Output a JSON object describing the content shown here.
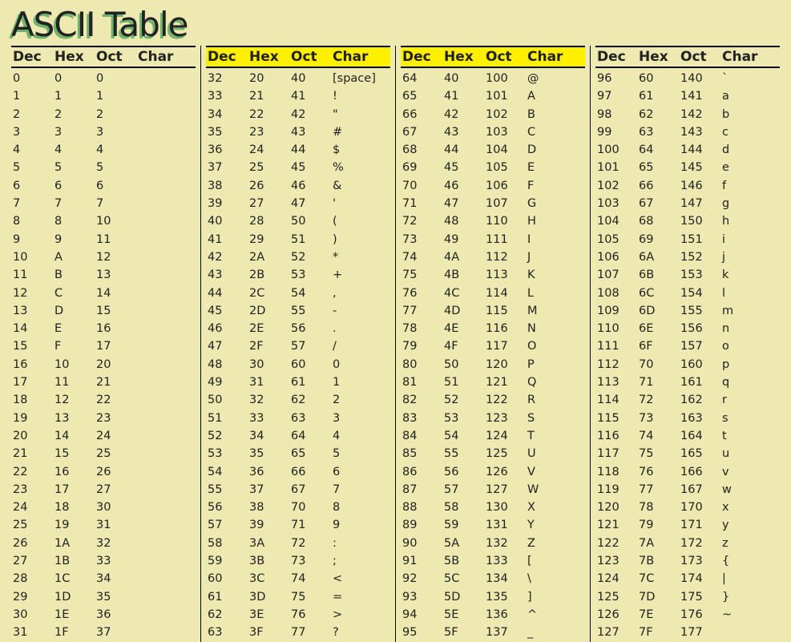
{
  "title": "ASCII Table",
  "headers": {
    "dec": "Dec",
    "hex": "Hex",
    "oct": "Oct",
    "char": "Char"
  },
  "highlight_blocks": [
    1,
    2
  ],
  "blocks": [
    [
      {
        "dec": "0",
        "hex": "0",
        "oct": "0",
        "char": ""
      },
      {
        "dec": "1",
        "hex": "1",
        "oct": "1",
        "char": ""
      },
      {
        "dec": "2",
        "hex": "2",
        "oct": "2",
        "char": ""
      },
      {
        "dec": "3",
        "hex": "3",
        "oct": "3",
        "char": ""
      },
      {
        "dec": "4",
        "hex": "4",
        "oct": "4",
        "char": ""
      },
      {
        "dec": "5",
        "hex": "5",
        "oct": "5",
        "char": ""
      },
      {
        "dec": "6",
        "hex": "6",
        "oct": "6",
        "char": ""
      },
      {
        "dec": "7",
        "hex": "7",
        "oct": "7",
        "char": ""
      },
      {
        "dec": "8",
        "hex": "8",
        "oct": "10",
        "char": ""
      },
      {
        "dec": "9",
        "hex": "9",
        "oct": "11",
        "char": ""
      },
      {
        "dec": "10",
        "hex": "A",
        "oct": "12",
        "char": ""
      },
      {
        "dec": "11",
        "hex": "B",
        "oct": "13",
        "char": ""
      },
      {
        "dec": "12",
        "hex": "C",
        "oct": "14",
        "char": ""
      },
      {
        "dec": "13",
        "hex": "D",
        "oct": "15",
        "char": ""
      },
      {
        "dec": "14",
        "hex": "E",
        "oct": "16",
        "char": ""
      },
      {
        "dec": "15",
        "hex": "F",
        "oct": "17",
        "char": ""
      },
      {
        "dec": "16",
        "hex": "10",
        "oct": "20",
        "char": ""
      },
      {
        "dec": "17",
        "hex": "11",
        "oct": "21",
        "char": ""
      },
      {
        "dec": "18",
        "hex": "12",
        "oct": "22",
        "char": ""
      },
      {
        "dec": "19",
        "hex": "13",
        "oct": "23",
        "char": ""
      },
      {
        "dec": "20",
        "hex": "14",
        "oct": "24",
        "char": ""
      },
      {
        "dec": "21",
        "hex": "15",
        "oct": "25",
        "char": ""
      },
      {
        "dec": "22",
        "hex": "16",
        "oct": "26",
        "char": ""
      },
      {
        "dec": "23",
        "hex": "17",
        "oct": "27",
        "char": ""
      },
      {
        "dec": "24",
        "hex": "18",
        "oct": "30",
        "char": ""
      },
      {
        "dec": "25",
        "hex": "19",
        "oct": "31",
        "char": ""
      },
      {
        "dec": "26",
        "hex": "1A",
        "oct": "32",
        "char": ""
      },
      {
        "dec": "27",
        "hex": "1B",
        "oct": "33",
        "char": ""
      },
      {
        "dec": "28",
        "hex": "1C",
        "oct": "34",
        "char": ""
      },
      {
        "dec": "29",
        "hex": "1D",
        "oct": "35",
        "char": ""
      },
      {
        "dec": "30",
        "hex": "1E",
        "oct": "36",
        "char": ""
      },
      {
        "dec": "31",
        "hex": "1F",
        "oct": "37",
        "char": ""
      }
    ],
    [
      {
        "dec": "32",
        "hex": "20",
        "oct": "40",
        "char": "[space]"
      },
      {
        "dec": "33",
        "hex": "21",
        "oct": "41",
        "char": "!"
      },
      {
        "dec": "34",
        "hex": "22",
        "oct": "42",
        "char": "\""
      },
      {
        "dec": "35",
        "hex": "23",
        "oct": "43",
        "char": "#"
      },
      {
        "dec": "36",
        "hex": "24",
        "oct": "44",
        "char": "$"
      },
      {
        "dec": "37",
        "hex": "25",
        "oct": "45",
        "char": "%"
      },
      {
        "dec": "38",
        "hex": "26",
        "oct": "46",
        "char": "&"
      },
      {
        "dec": "39",
        "hex": "27",
        "oct": "47",
        "char": "'"
      },
      {
        "dec": "40",
        "hex": "28",
        "oct": "50",
        "char": "("
      },
      {
        "dec": "41",
        "hex": "29",
        "oct": "51",
        "char": ")"
      },
      {
        "dec": "42",
        "hex": "2A",
        "oct": "52",
        "char": "*"
      },
      {
        "dec": "43",
        "hex": "2B",
        "oct": "53",
        "char": "+"
      },
      {
        "dec": "44",
        "hex": "2C",
        "oct": "54",
        "char": ","
      },
      {
        "dec": "45",
        "hex": "2D",
        "oct": "55",
        "char": "-"
      },
      {
        "dec": "46",
        "hex": "2E",
        "oct": "56",
        "char": "."
      },
      {
        "dec": "47",
        "hex": "2F",
        "oct": "57",
        "char": "/"
      },
      {
        "dec": "48",
        "hex": "30",
        "oct": "60",
        "char": "0"
      },
      {
        "dec": "49",
        "hex": "31",
        "oct": "61",
        "char": "1"
      },
      {
        "dec": "50",
        "hex": "32",
        "oct": "62",
        "char": "2"
      },
      {
        "dec": "51",
        "hex": "33",
        "oct": "63",
        "char": "3"
      },
      {
        "dec": "52",
        "hex": "34",
        "oct": "64",
        "char": "4"
      },
      {
        "dec": "53",
        "hex": "35",
        "oct": "65",
        "char": "5"
      },
      {
        "dec": "54",
        "hex": "36",
        "oct": "66",
        "char": "6"
      },
      {
        "dec": "55",
        "hex": "37",
        "oct": "67",
        "char": "7"
      },
      {
        "dec": "56",
        "hex": "38",
        "oct": "70",
        "char": "8"
      },
      {
        "dec": "57",
        "hex": "39",
        "oct": "71",
        "char": "9"
      },
      {
        "dec": "58",
        "hex": "3A",
        "oct": "72",
        "char": ":"
      },
      {
        "dec": "59",
        "hex": "3B",
        "oct": "73",
        "char": ";"
      },
      {
        "dec": "60",
        "hex": "3C",
        "oct": "74",
        "char": "<"
      },
      {
        "dec": "61",
        "hex": "3D",
        "oct": "75",
        "char": "="
      },
      {
        "dec": "62",
        "hex": "3E",
        "oct": "76",
        "char": ">"
      },
      {
        "dec": "63",
        "hex": "3F",
        "oct": "77",
        "char": "?"
      }
    ],
    [
      {
        "dec": "64",
        "hex": "40",
        "oct": "100",
        "char": "@"
      },
      {
        "dec": "65",
        "hex": "41",
        "oct": "101",
        "char": "A"
      },
      {
        "dec": "66",
        "hex": "42",
        "oct": "102",
        "char": "B"
      },
      {
        "dec": "67",
        "hex": "43",
        "oct": "103",
        "char": "C"
      },
      {
        "dec": "68",
        "hex": "44",
        "oct": "104",
        "char": "D"
      },
      {
        "dec": "69",
        "hex": "45",
        "oct": "105",
        "char": "E"
      },
      {
        "dec": "70",
        "hex": "46",
        "oct": "106",
        "char": "F"
      },
      {
        "dec": "71",
        "hex": "47",
        "oct": "107",
        "char": "G"
      },
      {
        "dec": "72",
        "hex": "48",
        "oct": "110",
        "char": "H"
      },
      {
        "dec": "73",
        "hex": "49",
        "oct": "111",
        "char": "I"
      },
      {
        "dec": "74",
        "hex": "4A",
        "oct": "112",
        "char": "J"
      },
      {
        "dec": "75",
        "hex": "4B",
        "oct": "113",
        "char": "K"
      },
      {
        "dec": "76",
        "hex": "4C",
        "oct": "114",
        "char": "L"
      },
      {
        "dec": "77",
        "hex": "4D",
        "oct": "115",
        "char": "M"
      },
      {
        "dec": "78",
        "hex": "4E",
        "oct": "116",
        "char": "N"
      },
      {
        "dec": "79",
        "hex": "4F",
        "oct": "117",
        "char": "O"
      },
      {
        "dec": "80",
        "hex": "50",
        "oct": "120",
        "char": "P"
      },
      {
        "dec": "81",
        "hex": "51",
        "oct": "121",
        "char": "Q"
      },
      {
        "dec": "82",
        "hex": "52",
        "oct": "122",
        "char": "R"
      },
      {
        "dec": "83",
        "hex": "53",
        "oct": "123",
        "char": "S"
      },
      {
        "dec": "84",
        "hex": "54",
        "oct": "124",
        "char": "T"
      },
      {
        "dec": "85",
        "hex": "55",
        "oct": "125",
        "char": "U"
      },
      {
        "dec": "86",
        "hex": "56",
        "oct": "126",
        "char": "V"
      },
      {
        "dec": "87",
        "hex": "57",
        "oct": "127",
        "char": "W"
      },
      {
        "dec": "88",
        "hex": "58",
        "oct": "130",
        "char": "X"
      },
      {
        "dec": "89",
        "hex": "59",
        "oct": "131",
        "char": "Y"
      },
      {
        "dec": "90",
        "hex": "5A",
        "oct": "132",
        "char": "Z"
      },
      {
        "dec": "91",
        "hex": "5B",
        "oct": "133",
        "char": "["
      },
      {
        "dec": "92",
        "hex": "5C",
        "oct": "134",
        "char": "\\"
      },
      {
        "dec": "93",
        "hex": "5D",
        "oct": "135",
        "char": "]"
      },
      {
        "dec": "94",
        "hex": "5E",
        "oct": "136",
        "char": "^"
      },
      {
        "dec": "95",
        "hex": "5F",
        "oct": "137",
        "char": "_"
      }
    ],
    [
      {
        "dec": "96",
        "hex": "60",
        "oct": "140",
        "char": "`"
      },
      {
        "dec": "97",
        "hex": "61",
        "oct": "141",
        "char": "a"
      },
      {
        "dec": "98",
        "hex": "62",
        "oct": "142",
        "char": "b"
      },
      {
        "dec": "99",
        "hex": "63",
        "oct": "143",
        "char": "c"
      },
      {
        "dec": "100",
        "hex": "64",
        "oct": "144",
        "char": "d"
      },
      {
        "dec": "101",
        "hex": "65",
        "oct": "145",
        "char": "e"
      },
      {
        "dec": "102",
        "hex": "66",
        "oct": "146",
        "char": "f"
      },
      {
        "dec": "103",
        "hex": "67",
        "oct": "147",
        "char": "g"
      },
      {
        "dec": "104",
        "hex": "68",
        "oct": "150",
        "char": "h"
      },
      {
        "dec": "105",
        "hex": "69",
        "oct": "151",
        "char": "i"
      },
      {
        "dec": "106",
        "hex": "6A",
        "oct": "152",
        "char": "j"
      },
      {
        "dec": "107",
        "hex": "6B",
        "oct": "153",
        "char": "k"
      },
      {
        "dec": "108",
        "hex": "6C",
        "oct": "154",
        "char": "l"
      },
      {
        "dec": "109",
        "hex": "6D",
        "oct": "155",
        "char": "m"
      },
      {
        "dec": "110",
        "hex": "6E",
        "oct": "156",
        "char": "n"
      },
      {
        "dec": "111",
        "hex": "6F",
        "oct": "157",
        "char": "o"
      },
      {
        "dec": "112",
        "hex": "70",
        "oct": "160",
        "char": "p"
      },
      {
        "dec": "113",
        "hex": "71",
        "oct": "161",
        "char": "q"
      },
      {
        "dec": "114",
        "hex": "72",
        "oct": "162",
        "char": "r"
      },
      {
        "dec": "115",
        "hex": "73",
        "oct": "163",
        "char": "s"
      },
      {
        "dec": "116",
        "hex": "74",
        "oct": "164",
        "char": "t"
      },
      {
        "dec": "117",
        "hex": "75",
        "oct": "165",
        "char": "u"
      },
      {
        "dec": "118",
        "hex": "76",
        "oct": "166",
        "char": "v"
      },
      {
        "dec": "119",
        "hex": "77",
        "oct": "167",
        "char": "w"
      },
      {
        "dec": "120",
        "hex": "78",
        "oct": "170",
        "char": "x"
      },
      {
        "dec": "121",
        "hex": "79",
        "oct": "171",
        "char": "y"
      },
      {
        "dec": "122",
        "hex": "7A",
        "oct": "172",
        "char": "z"
      },
      {
        "dec": "123",
        "hex": "7B",
        "oct": "173",
        "char": "{"
      },
      {
        "dec": "124",
        "hex": "7C",
        "oct": "174",
        "char": "|"
      },
      {
        "dec": "125",
        "hex": "7D",
        "oct": "175",
        "char": "}"
      },
      {
        "dec": "126",
        "hex": "7E",
        "oct": "176",
        "char": "~"
      },
      {
        "dec": "127",
        "hex": "7F",
        "oct": "177",
        "char": ""
      }
    ]
  ]
}
